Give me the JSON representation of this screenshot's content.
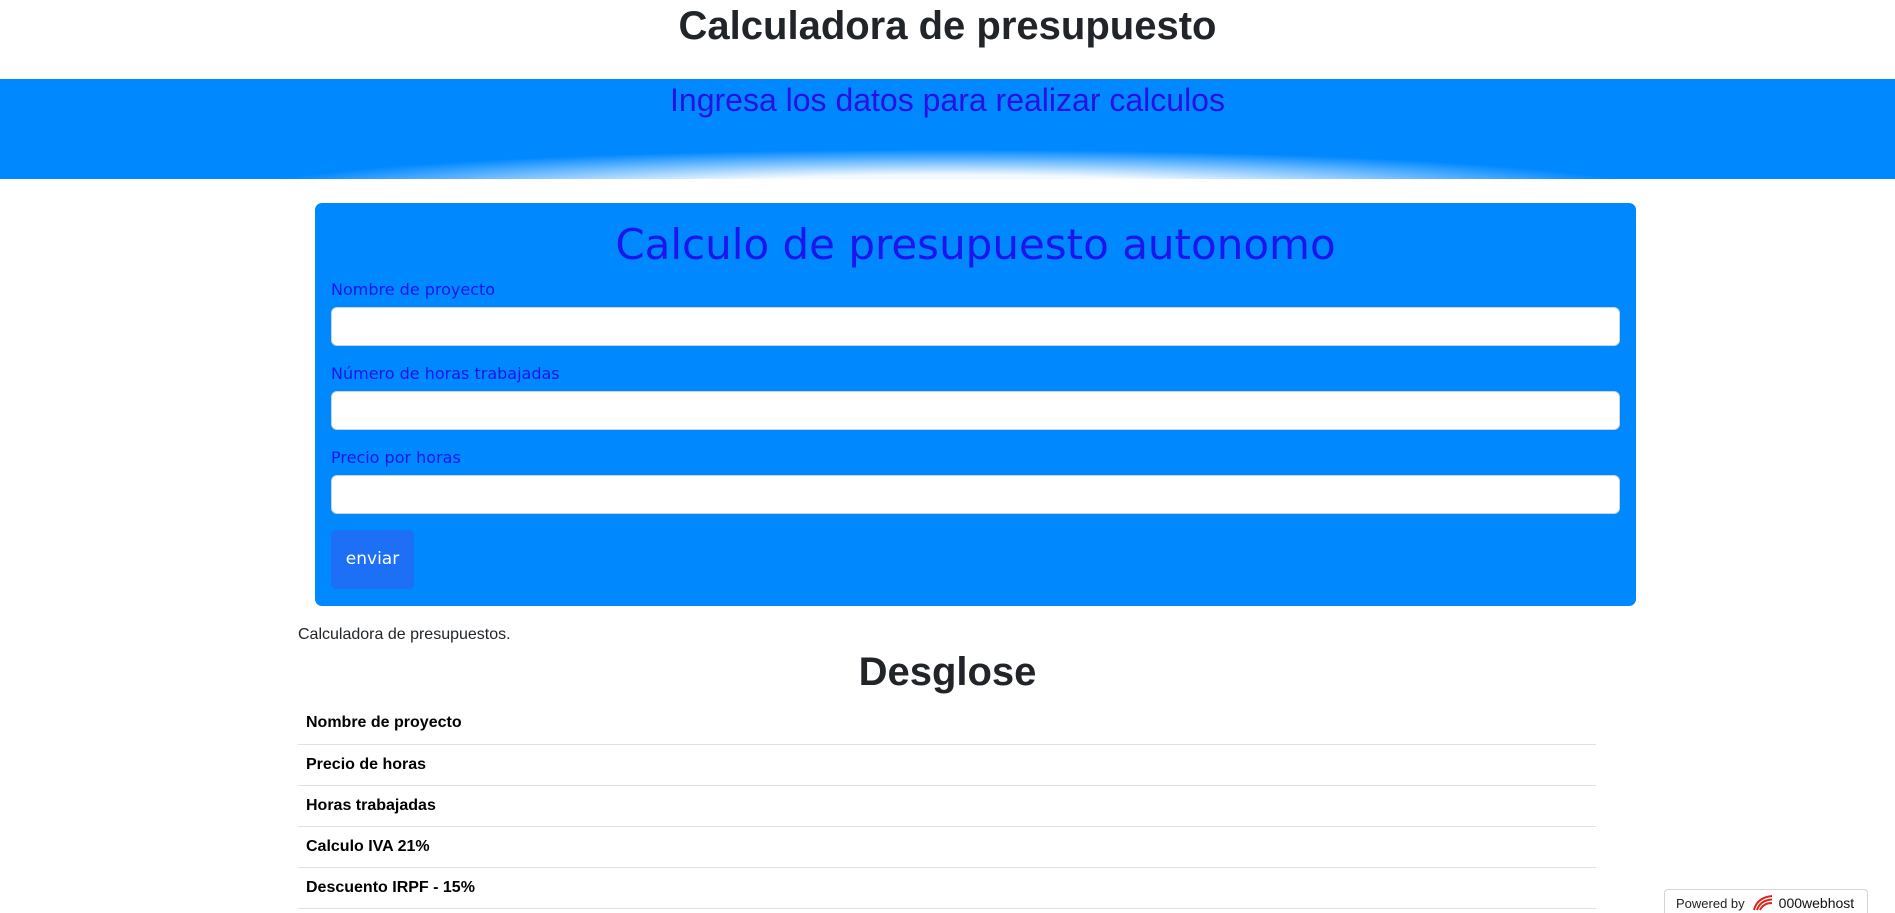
{
  "header": {
    "title": "Calculadora de presupuesto"
  },
  "banner": {
    "subtitle": "Ingresa los datos para realizar calculos",
    "background_color": "#0088ff",
    "text_color": "#2b10e6"
  },
  "form": {
    "heading": "Calculo de presupuesto autonomo",
    "fields": [
      {
        "label": "Nombre de proyecto",
        "value": "",
        "placeholder": ""
      },
      {
        "label": "Número de horas trabajadas",
        "value": "",
        "placeholder": ""
      },
      {
        "label": "Precio por horas",
        "value": "",
        "placeholder": ""
      }
    ],
    "submit_label": "enviar",
    "background_color": "#0088ff",
    "button_color": "#1d6ff5"
  },
  "footer_note": "Calculadora de presupuestos.",
  "breakdown": {
    "title": "Desglose",
    "rows": [
      {
        "label": "Nombre de proyecto"
      },
      {
        "label": "Precio de horas"
      },
      {
        "label": "Horas trabajadas"
      },
      {
        "label": "Calculo IVA 21%"
      },
      {
        "label": "Descuento IRPF - 15%"
      }
    ]
  },
  "host_badge": {
    "powered_by": "Powered by",
    "name": "000webhost",
    "logo_icon": "000webhost-logo-icon",
    "logo_color": "#e2231a"
  }
}
